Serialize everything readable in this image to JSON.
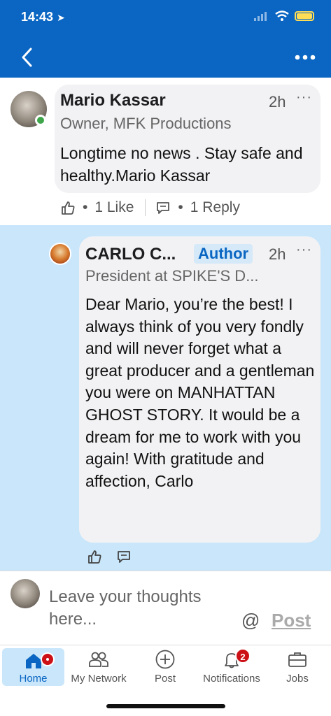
{
  "status": {
    "time": "14:43"
  },
  "comment": {
    "author": "Mario Kassar",
    "time": "2h",
    "headline": "Owner, MFK Productions",
    "text": "Longtime no news . Stay safe and healthy.Mario Kassar",
    "likes_label": "1 Like",
    "replies_label": "1 Reply"
  },
  "reply": {
    "author": "CARLO C...",
    "badge": "Author",
    "time": "2h",
    "headline": "President at SPIKE'S D...",
    "text": "Dear Mario, you’re the best! I always think of you very fondly and will never forget what a great producer and a gentleman you were on MANHATTAN GHOST STORY. It would be a dream for me to work with you again! With gratitude and affection, Carlo"
  },
  "composer": {
    "placeholder": "Leave your thoughts here...",
    "mention": "@",
    "post_label": "Post"
  },
  "tabs": [
    {
      "label": "Home",
      "icon": "home-icon"
    },
    {
      "label": "My Network",
      "icon": "network-icon"
    },
    {
      "label": "Post",
      "icon": "plus-circle-icon"
    },
    {
      "label": "Notifications",
      "icon": "bell-icon",
      "badge": "2"
    },
    {
      "label": "Jobs",
      "icon": "briefcase-icon"
    }
  ],
  "colors": {
    "brand": "#0a66c2",
    "highlight": "#c9e6fb",
    "badge_red": "#cc1016",
    "online": "#3fa54a"
  }
}
